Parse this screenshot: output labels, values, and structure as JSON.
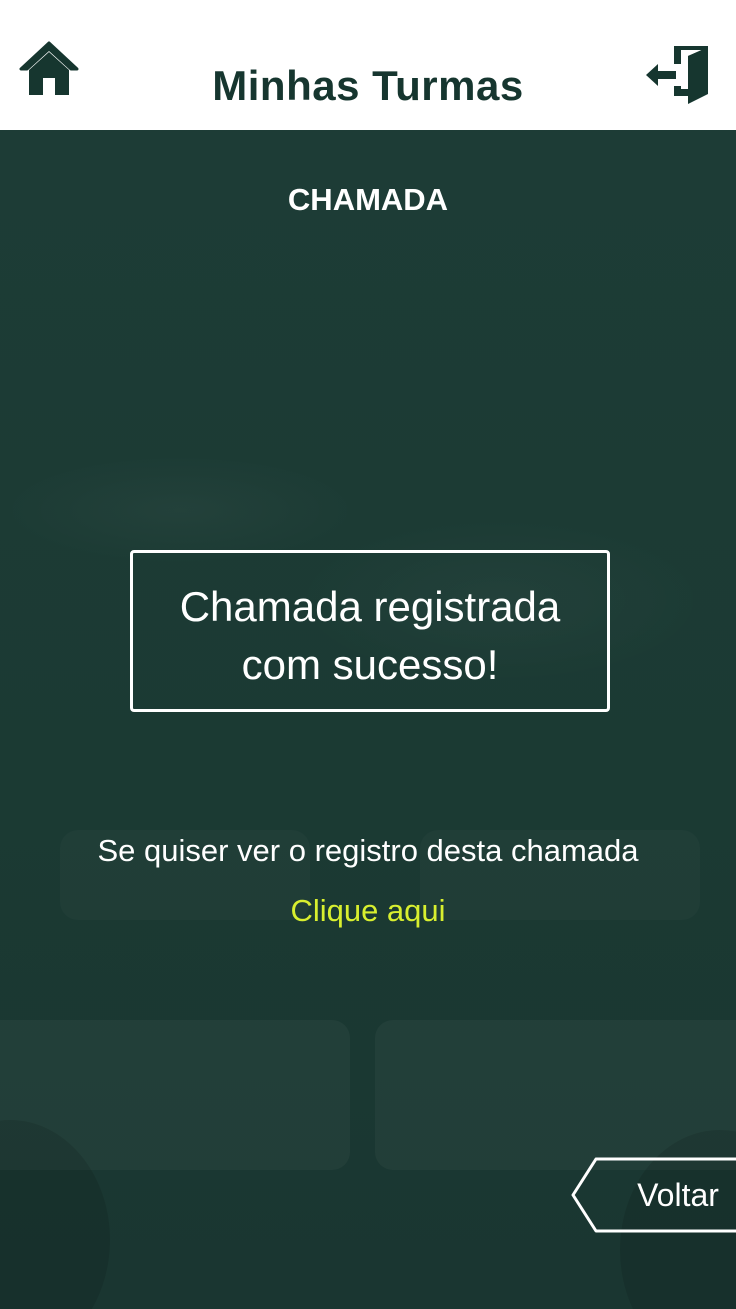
{
  "header": {
    "title": "Minhas Turmas",
    "home_icon": "home-icon",
    "logout_icon": "logout-door-icon"
  },
  "section": {
    "title": "CHAMADA"
  },
  "success": {
    "message_line1": "Chamada registrada",
    "message_line2": "com sucesso!"
  },
  "info": {
    "text": "Se quiser ver o registro desta chamada",
    "link_label": "Clique aqui"
  },
  "footer": {
    "back_label": "Voltar"
  },
  "colors": {
    "header_bg": "#ffffff",
    "primary_dark": "#16362f",
    "background": "#1b3a33",
    "link": "#d8ef2f",
    "text": "#ffffff"
  }
}
